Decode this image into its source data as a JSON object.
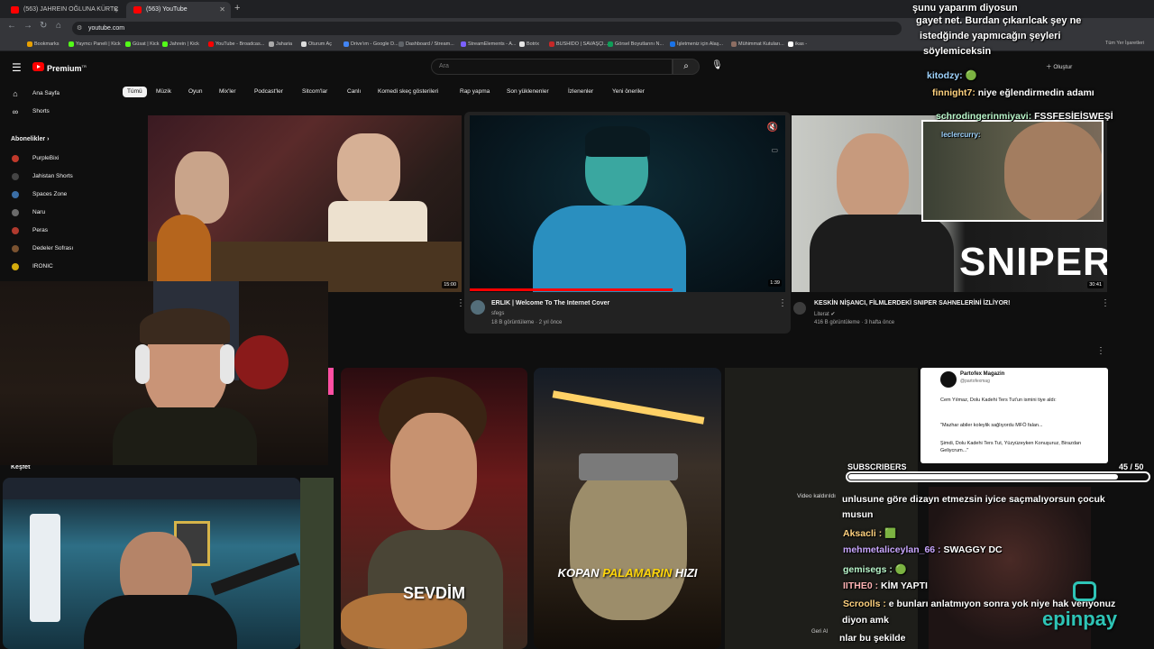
{
  "browser": {
    "tabs": [
      {
        "title": "(563) JAHREIN OĞLUNA KÜRTÇ"
      },
      {
        "title": "(563) YouTube"
      }
    ],
    "url": "youtube.com",
    "bookmarks": [
      "Bookmarks",
      "Yaymcı Paneli | Kick",
      "Güsat | Kick",
      "Jahrein | Kick",
      "YouTube - Broadcas...",
      "Jaharia",
      "Oturum Aç",
      "Drive'ım - Google D...",
      "Dashboard / Stream...",
      "StreamElements - A...",
      "Botrix",
      "BUSHIDO | SAVAŞÇI...",
      "Görsel Boyutlarını N...",
      "İşletmeniz için Alaş...",
      "Mühimmat Kutuları...",
      "ikas -"
    ],
    "bookmark_colors": [
      "#e8a000",
      "#53fc18",
      "#53fc18",
      "#53fc18",
      "#ff0000",
      "#aaaaaa",
      "#dddddd",
      "#4285f4",
      "#5f6368",
      "#7b61ff",
      "#e5e5e5",
      "#c62828",
      "#0f9d58",
      "#1a73e8",
      "#8d6e63",
      "#ffffff"
    ],
    "right_bookmark": "Tüm Yer İşaretleri"
  },
  "youtube": {
    "logo_text": "Premium",
    "logo_sup": "TR",
    "search_placeholder": "Ara",
    "create_label": "Oluştur",
    "chips": [
      "Tümü",
      "Müzik",
      "Oyun",
      "Mix'ler",
      "Podcast'ler",
      "Sitcom'lar",
      "Canlı",
      "Komedi skeç gösterileri",
      "Rap yapma",
      "Son yüklenenler",
      "İzlenenler",
      "Yeni öneriler"
    ],
    "sidebar": {
      "home": "Ana Sayfa",
      "shorts": "Shorts",
      "subs_header": "Abonelikler",
      "subscriptions": [
        {
          "name": "PurpleBixi",
          "color": "#c0392b"
        },
        {
          "name": "Jahistan Shorts",
          "color": "#444444"
        },
        {
          "name": "Spaces Zone",
          "color": "#3b6ea5"
        },
        {
          "name": "Naru",
          "color": "#6b6b6b"
        },
        {
          "name": "Peras",
          "color": "#b03a2e"
        },
        {
          "name": "Dedeler Sofrası",
          "color": "#7a5230"
        },
        {
          "name": "IRONIC",
          "color": "#d4ac0d"
        }
      ],
      "explore": "Keşfet"
    },
    "videos": [
      {
        "duration": "15:00"
      },
      {
        "title": "ERLIK | Welcome To The Internet Cover",
        "channel": "sfegs",
        "meta": "18 B görüntüleme · 2 yıl önce",
        "duration": "1:39"
      },
      {
        "title": "KESKİN NİŞANCI, FİLMLERDEKİ SNIPER SAHNELERİNİ İZLİYOR!",
        "channel": "Literat",
        "meta": "416 B görüntüleme · 3 hafta önce",
        "duration": "30:41",
        "thumb_text": "SNIPER"
      }
    ],
    "shorts_row": [
      {
        "caption": "SEVDİM"
      },
      {
        "caption_part1": "KOPAN",
        "caption_part2": "PALAMARIN",
        "caption_part3": "HIZI"
      }
    ],
    "removed_label": "Video kaldırıldı",
    "undo_label": "Geri Al",
    "tweet": {
      "name": "Partofex Magazin",
      "handle": "@partofexmag",
      "line1": "Cem Yılmaz, Dolu Kadehi Ters Tut'un ismini tiye aldı:",
      "line2": "\"Mazhar abiler koleylik sağlıyordu MFÖ falan...",
      "line3": "Şimdi, Dolu Kadehi Ters Tut, Yüzyüzeyken Konuşuruz, Birazdan Geliycrum...\""
    }
  },
  "overlay": {
    "top_chat": [
      "şunu yaparım diyosun",
      "gayet net. Burdan çıkarılcak şey ne",
      "istedğinde yapmıcağın şeyleri",
      "söylemiceksin"
    ],
    "chat_top": [
      {
        "user": "kitodzy:",
        "msg": "🟢"
      },
      {
        "user": "finnight7:",
        "msg": "niye eğlendirmedin adamı"
      },
      {
        "user": "schrodingerinmiyavi:",
        "msg": "FSSFESİEİSWEŞİ"
      },
      {
        "user": "leclercurry:",
        "msg": ""
      }
    ],
    "subs_label": "SUBSCRIBERS",
    "subs_count": "45 / 50",
    "subs_progress": 0.9,
    "chat_bottom": [
      {
        "user": "",
        "msg": "unlusune göre dizayn etmezsin iyice saçmalıyorsun çocuk"
      },
      {
        "user": "",
        "msg": "musun"
      },
      {
        "user": "Aksacli :",
        "msg": "🟩"
      },
      {
        "user": "mehmetaliceylan_66 :",
        "msg": "SWAGGY DC"
      },
      {
        "user": "gemisegs :",
        "msg": "🟢"
      },
      {
        "user": "IITHE0 :",
        "msg": "KİM YAPTI"
      },
      {
        "user": "Scroolls :",
        "msg": "e bunları anlatmıyon sonra yok niye hak veriyonuz"
      },
      {
        "user": "",
        "msg": "diyon amk"
      },
      {
        "user": "",
        "msg": "nlar bu şekilde"
      }
    ],
    "sponsor": "epinpay"
  }
}
